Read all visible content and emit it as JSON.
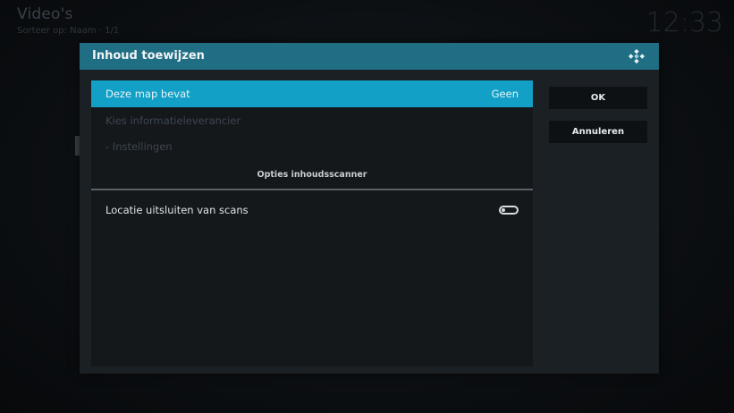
{
  "background": {
    "title": "Video's",
    "subtitle": "Sorteer op: Naam  ·  1/1",
    "clock": "12:33"
  },
  "dialog": {
    "title": "Inhoud toewijzen",
    "header_color": "#1f6e84",
    "accent_color": "#12a0c6",
    "rows": [
      {
        "label": "Deze map bevat",
        "value": "Geen"
      },
      {
        "label": "Kies informatieleverancier"
      },
      {
        "label": "- Instellingen"
      }
    ],
    "section_header": "Opties inhoudsscanner",
    "options": [
      {
        "label": "Locatie uitsluiten van scans",
        "enabled": false
      }
    ],
    "buttons": {
      "ok": "OK",
      "cancel": "Annuleren"
    }
  }
}
